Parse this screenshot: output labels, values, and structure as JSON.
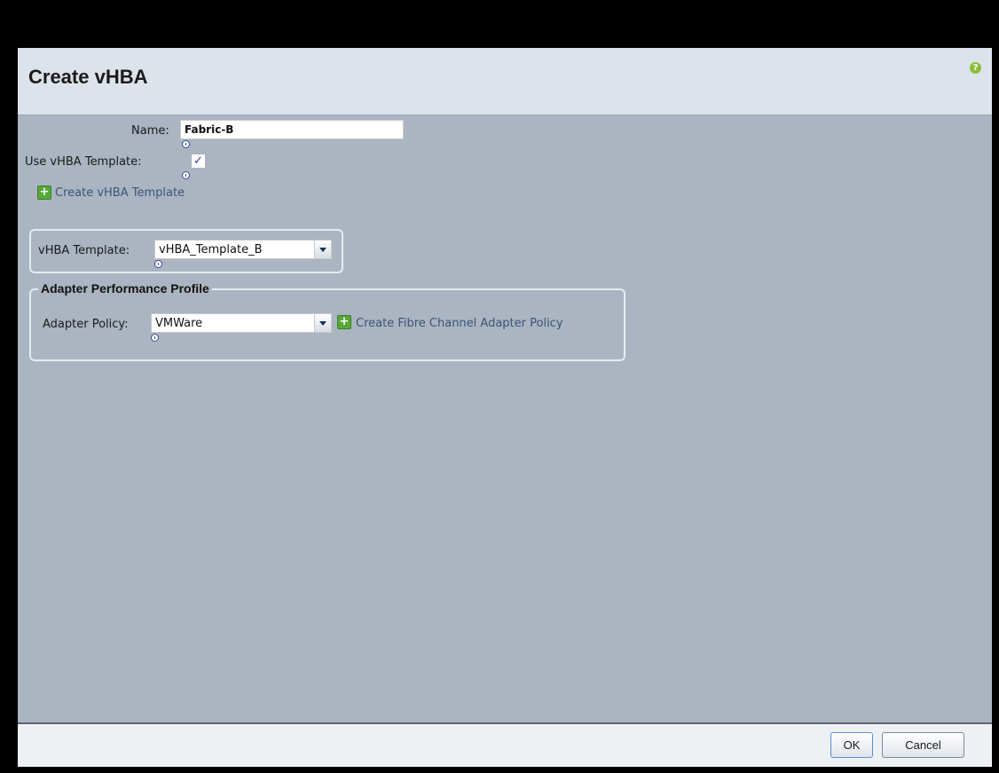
{
  "dialog": {
    "title": "Create vHBA",
    "help_icon": "?"
  },
  "form": {
    "name_label": "Name:",
    "name_value": "Fabric-B",
    "use_template_label": "Use vHBA Template:",
    "use_template_checked": true,
    "check_glyph": "✓",
    "create_template_link": "Create vHBA Template",
    "template_label": "vHBA Template:",
    "template_value": "vHBA_Template_B"
  },
  "adapter_panel": {
    "legend": "Adapter Performance Profile",
    "policy_label": "Adapter Policy:",
    "policy_value": "VMWare",
    "create_policy_link": "Create Fibre Channel Adapter Policy"
  },
  "footer": {
    "ok_label": "OK",
    "cancel_label": "Cancel"
  },
  "icons": {
    "plus_glyph": "+"
  }
}
